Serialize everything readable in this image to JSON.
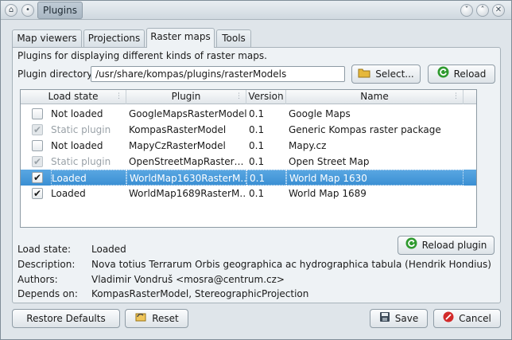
{
  "window": {
    "title_tab": "Plugins",
    "pin_icon": "pin-icon",
    "minimize_icon": "chevron-down-icon",
    "maximize_icon": "chevron-up-icon",
    "close_icon": "close-icon"
  },
  "tabs": [
    {
      "label": "Map viewers"
    },
    {
      "label": "Projections"
    },
    {
      "label": "Raster maps"
    },
    {
      "label": "Tools"
    }
  ],
  "active_tab": "Raster maps",
  "pane": {
    "description": "Plugins for displaying different kinds of raster maps.",
    "dir_label": "Plugin directory:",
    "dir_value": "/usr/share/kompas/plugins/rasterModels",
    "select_label": "Select...",
    "reload_label": "Reload"
  },
  "table": {
    "headers": [
      "Load state",
      "Plugin",
      "Version",
      "Name"
    ],
    "rows": [
      {
        "state": "Not loaded",
        "plugin": "GoogleMapsRasterModel",
        "version": "0.1",
        "name": "Google Maps",
        "checked": false,
        "disabled": false,
        "selected": false
      },
      {
        "state": "Static plugin",
        "plugin": "KompasRasterModel",
        "version": "0.1",
        "name": "Generic Kompas raster package",
        "checked": true,
        "disabled": true,
        "selected": false
      },
      {
        "state": "Not loaded",
        "plugin": "MapyCzRasterModel",
        "version": "0.1",
        "name": "Mapy.cz",
        "checked": false,
        "disabled": false,
        "selected": false
      },
      {
        "state": "Static plugin",
        "plugin": "OpenStreetMapRaster…",
        "version": "0.1",
        "name": "Open Street Map",
        "checked": true,
        "disabled": true,
        "selected": false
      },
      {
        "state": "Loaded",
        "plugin": "WorldMap1630RasterM…",
        "version": "0.1",
        "name": "World Map 1630",
        "checked": true,
        "disabled": false,
        "selected": true
      },
      {
        "state": "Loaded",
        "plugin": "WorldMap1689RasterM…",
        "version": "0.1",
        "name": "World Map 1689",
        "checked": true,
        "disabled": false,
        "selected": false
      }
    ]
  },
  "details": {
    "load_state_label": "Load state:",
    "load_state_value": "Loaded",
    "description_label": "Description:",
    "description_value": "Nova totius Terrarum Orbis geographica ac hydrographica tabula (Hendrik Hondius)",
    "authors_label": "Authors:",
    "authors_value": "Vladimir Vondruš <mosra@centrum.cz>",
    "depends_label": "Depends on:",
    "depends_value": "KompasRasterModel, StereographicProjection",
    "reload_plugin_label": "Reload plugin"
  },
  "footer": {
    "restore_label": "Restore Defaults",
    "reset_label": "Reset",
    "save_label": "Save",
    "cancel_label": "Cancel"
  },
  "colors": {
    "selection": "#3a8fd3",
    "reload_green": "#2f9a2f",
    "cancel_red": "#d22a2a"
  }
}
